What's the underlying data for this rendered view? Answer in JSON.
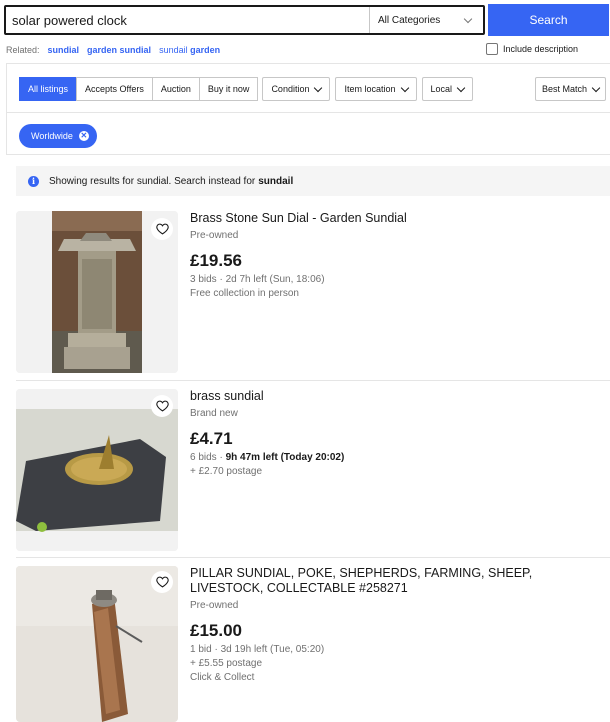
{
  "search": {
    "query": "solar powered clock",
    "category": "All Categories",
    "button_label": "Search"
  },
  "related": {
    "label": "Related:",
    "items": [
      "sundial",
      "garden sundial",
      "sundail",
      "garden"
    ]
  },
  "include_description": "Include description",
  "filters": {
    "tabs": [
      "All listings",
      "Accepts Offers",
      "Auction",
      "Buy it now"
    ],
    "dropdowns": [
      "Condition",
      "Item location",
      "Local"
    ],
    "sort": "Best Match",
    "chip": "Worldwide"
  },
  "banner": {
    "text": "Showing results for sundial. Search instead for",
    "alt_query": "sundail"
  },
  "listings": [
    {
      "title": "Brass Stone Sun Dial - Garden Sundial",
      "condition": "Pre-owned",
      "price": "£19.56",
      "bids": "3 bids",
      "time_left": "2d 7h left (Sun, 18:06)",
      "extra": [
        "Free collection in person"
      ]
    },
    {
      "title": "brass sundial",
      "condition": "Brand new",
      "price": "£4.71",
      "bids": "6 bids",
      "time_left": "9h 47m left (Today 20:02)",
      "extra": [
        "+ £2.70 postage"
      ]
    },
    {
      "title": "PILLAR SUNDIAL, POKE, SHEPHERDS, FARMING, SHEEP, LIVESTOCK, COLLECTABLE #258271",
      "condition": "Pre-owned",
      "price": "£15.00",
      "bids": "1 bid",
      "time_left": "3d 19h left (Tue, 05:20)",
      "extra": [
        "+ £5.55 postage",
        "Click & Collect"
      ]
    }
  ],
  "colors": {
    "accent": "#3665f3",
    "text": "#191919",
    "muted": "#707070"
  }
}
